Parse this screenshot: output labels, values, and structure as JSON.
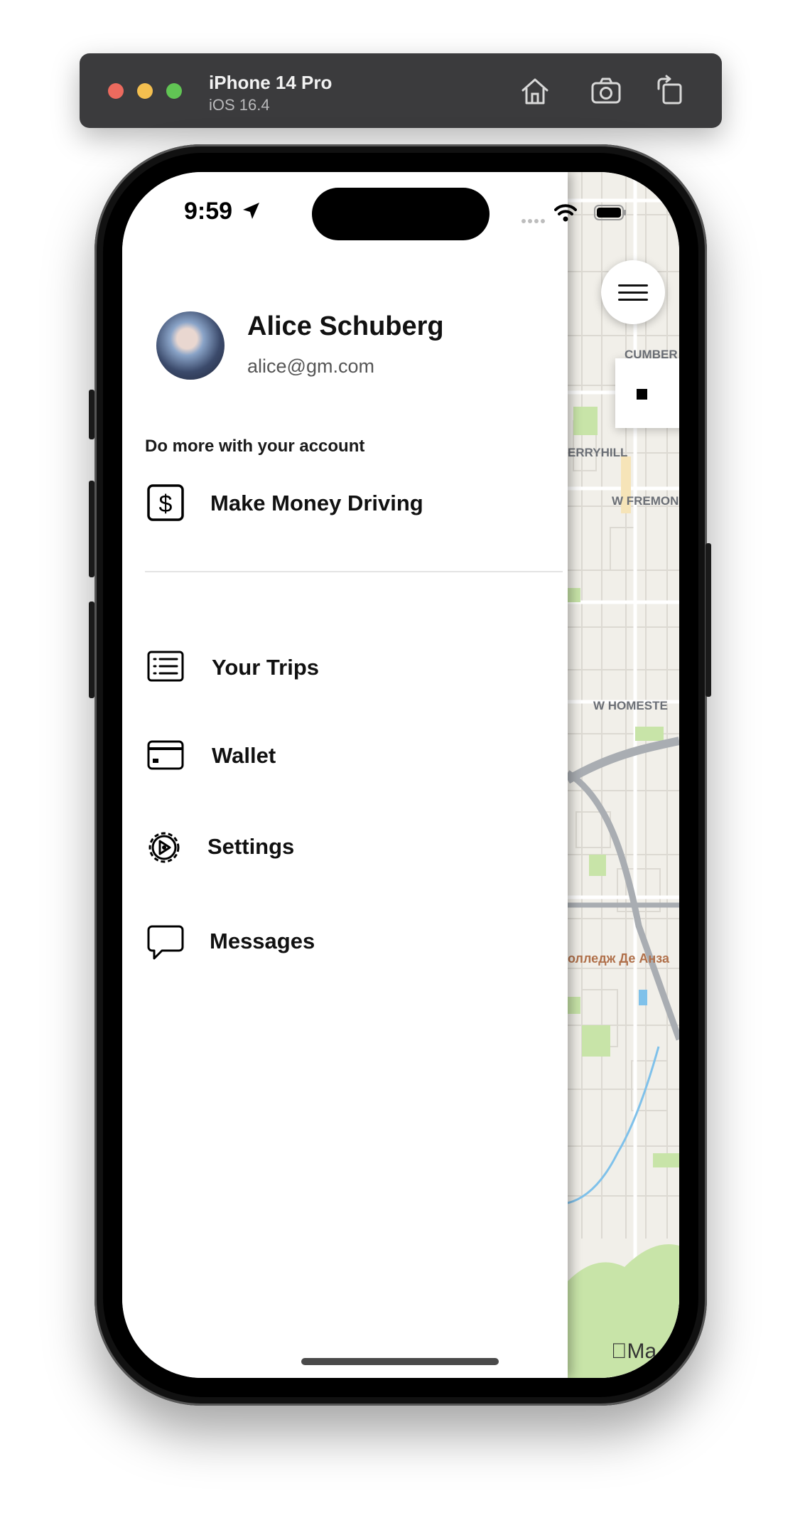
{
  "simulator": {
    "device_name": "iPhone 14 Pro",
    "os_version": "iOS 16.4",
    "toolbar_buttons": [
      "home-icon",
      "screenshot-icon",
      "rotate-icon"
    ]
  },
  "status_bar": {
    "time": "9:59"
  },
  "profile": {
    "name": "Alice Schuberg",
    "email": "alice@gm.com"
  },
  "account": {
    "section_title": "Do more with your account",
    "make_money_label": "Make Money Driving"
  },
  "menu": {
    "items": [
      {
        "label": "Your Trips",
        "icon": "trips-list-icon"
      },
      {
        "label": "Wallet",
        "icon": "wallet-card-icon"
      },
      {
        "label": "Settings",
        "icon": "gear-icon"
      },
      {
        "label": "Messages",
        "icon": "message-bubble-icon"
      }
    ]
  },
  "map": {
    "street_labels": [
      "CUMBER",
      "ERRYHILL",
      "W FREMON",
      "W HOMESTE",
      "олледж Де Анза"
    ],
    "attribution": "Ma"
  },
  "colors": {
    "map_background": "#f1efe9",
    "park_green": "#c8e4a8",
    "highway_gray": "#a9adb2",
    "college_label": "#b0704a"
  }
}
